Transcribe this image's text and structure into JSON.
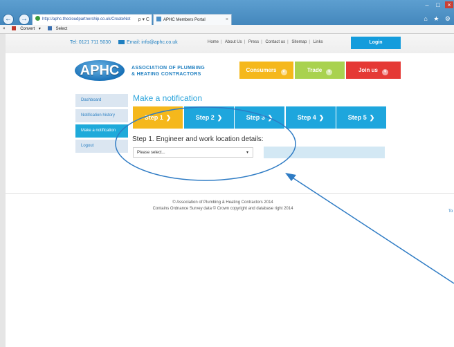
{
  "browser": {
    "address": "http://aphc.thecloudpartnership.co.uk/CreateNot",
    "address_controls": "ρ ▾ C",
    "tab_title": "APHC Members Portal",
    "tab_close": "×",
    "back_glyph": "←",
    "forward_glyph": "→",
    "win_min": "–",
    "win_max": "□",
    "win_close": "×",
    "top_icons": "⌂ ★ ⚙",
    "cmd_close": "×",
    "cmd_convert": "Convert",
    "cmd_convert_arrow": "▾",
    "cmd_select": "Select"
  },
  "topbar": {
    "phone": "Tel: 0121 711 5030",
    "email": "Email: info@aphc.co.uk",
    "links": [
      "Home",
      "About Us",
      "Press",
      "Contact us",
      "Sitemap",
      "Links"
    ],
    "separator": "|",
    "login": "Login"
  },
  "header": {
    "logo": "APHC",
    "logo_line1": "Association Of Plumbing",
    "logo_line2": "& Heating Contractors",
    "consumers": "Consumers",
    "trade": "Trade",
    "join": "Join us",
    "dropdown_glyph": "▾"
  },
  "sidebar": {
    "items": [
      {
        "label": "Dashboard"
      },
      {
        "label": "Notification history"
      },
      {
        "label": "Make a notification"
      },
      {
        "label": "Logout"
      }
    ]
  },
  "main": {
    "title": "Make a notification",
    "steps": [
      "Step 1",
      "Step 2",
      "Step 3",
      "Step 4",
      "Step 5"
    ],
    "step_arrow": "❯",
    "step_heading": "Step 1. Engineer and work location details:",
    "select_value": "Please select...",
    "select_caret": "▾"
  },
  "footer": {
    "line1": "© Association of Plumbing & Heating Contractors 2014",
    "line2": "Contains Ordnance Survey data © Crown copyright and database right 2014",
    "edge": "To"
  },
  "colors": {
    "accent": "#1ea6dd",
    "active_step": "#f5b81c",
    "consumers": "#f5b81c",
    "trade": "#a9d24f",
    "join": "#e53935",
    "annotation": "#2e7bc4"
  }
}
